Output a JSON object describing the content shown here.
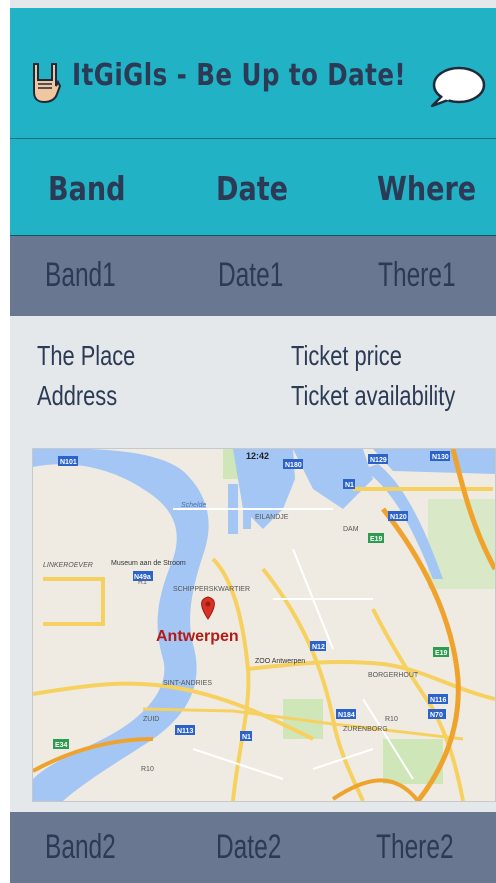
{
  "header": {
    "title": "ItGiGls - Be Up to Date!",
    "left_icon": "rock-hand-icon",
    "right_icon": "speech-bubble-icon"
  },
  "columns": {
    "band": "Band",
    "date": "Date",
    "where": "Where"
  },
  "rows": [
    {
      "band": "Band1",
      "date": "Date1",
      "where": "There1"
    },
    {
      "band": "Band2",
      "date": "Date2",
      "where": "There2"
    }
  ],
  "detail": {
    "place": "The Place",
    "address": "Address",
    "ticket_price": "Ticket price",
    "ticket_availability": "Ticket availability"
  },
  "map": {
    "time": "12:42",
    "city": "Antwerpen",
    "labels": {
      "n101": "N101",
      "n180": "N180",
      "n129": "N129",
      "n130": "N130",
      "n1": "N1",
      "n120": "N120",
      "n49a": "N49a",
      "e19": "E19",
      "e34": "E34",
      "n12": "N12",
      "n113": "N113",
      "n184": "N184",
      "r10": "R10",
      "n116": "N116",
      "n70": "N70",
      "n1b": "N1",
      "dam": "DAM",
      "linkeroever": "LINKEROEVER",
      "museum": "Museum aan de Stroom",
      "schipperskwartier": "SCHIPPERSKWARTIER",
      "zoo": "ZOO Antwerpen",
      "sint_andries": "SINT-ANDRIES",
      "zuid": "ZUID",
      "borgerhout": "BORGERHOUT",
      "zurenborg": "ZURENBORG",
      "eilandje": "EILANDJE",
      "schelde": "Schelde",
      "r1": "R1",
      "e19b": "E19",
      "r10b": "R10"
    }
  },
  "colors": {
    "accent": "#21b2c6",
    "row_bg": "#6a7791",
    "text_dark": "#2c3a55",
    "panel_bg": "#e5e8eb"
  }
}
